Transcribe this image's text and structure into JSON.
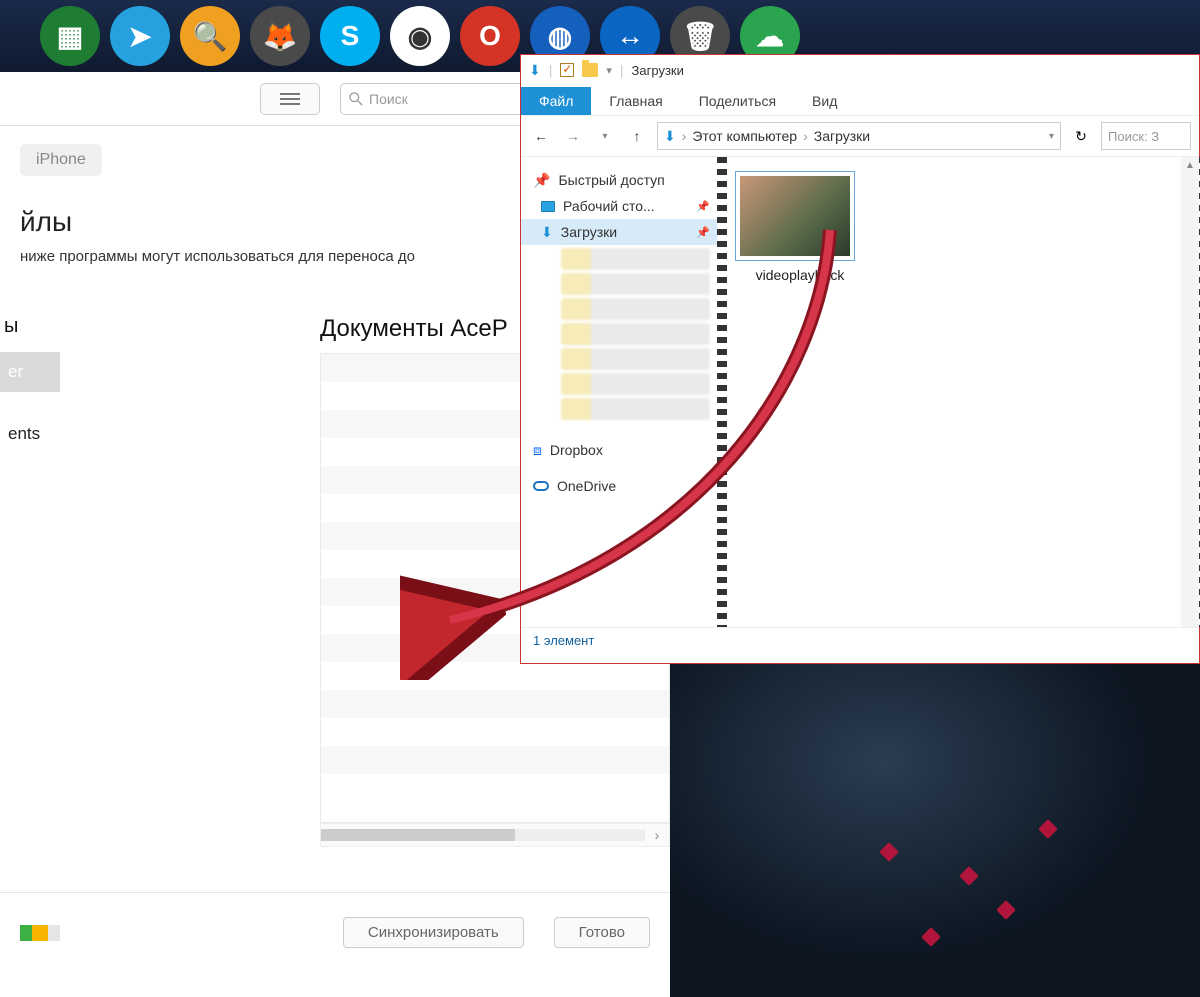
{
  "taskbar": {
    "icons": [
      "excel-icon",
      "telegram-icon",
      "search-icon",
      "gimp-icon",
      "skype-icon",
      "chrome-icon",
      "opera-icon",
      "app-icon",
      "teamviewer-icon",
      "basket-icon",
      "cloud-icon"
    ]
  },
  "itunes": {
    "search_placeholder": "Поиск",
    "tab": "iPhone",
    "section_title_suffix": "йлы",
    "section_desc": "ниже программы могут использоваться для переноса до",
    "left_items": [
      {
        "label": "ы"
      },
      {
        "label": "er",
        "selected": true
      },
      {
        "label": "ents"
      }
    ],
    "right_header": "Документы AceP",
    "sync_btn": "Синхронизировать",
    "done_btn": "Готово"
  },
  "explorer": {
    "title": "Загрузки",
    "tabs": {
      "file": "Файл",
      "home": "Главная",
      "share": "Поделиться",
      "view": "Вид"
    },
    "breadcrumb": {
      "root": "Этот компьютер",
      "folder": "Загрузки"
    },
    "search_placeholder": "Поиск: З",
    "sidebar": {
      "quick_access": "Быстрый доступ",
      "desktop": "Рабочий сто...",
      "downloads": "Загрузки",
      "dropbox": "Dropbox",
      "onedrive": "OneDrive"
    },
    "file": {
      "name": "videoplayback"
    },
    "status": "1 элемент"
  }
}
